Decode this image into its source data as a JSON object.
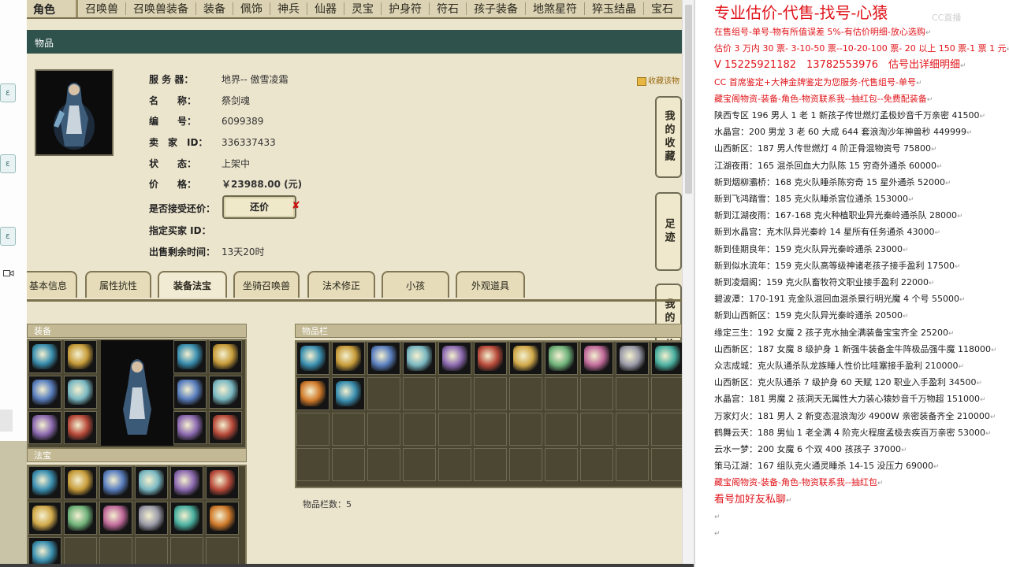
{
  "left": {
    "video_icon": "video-camera-icon"
  },
  "nav": {
    "first": "角色",
    "items": [
      "召唤兽",
      "召唤兽装备",
      "装备",
      "佩饰",
      "神兵",
      "仙器",
      "灵宝",
      "护身符",
      "符石",
      "孩子装备",
      "地煞星符",
      "猝玉结晶",
      "宝石"
    ]
  },
  "panel_title": "物品",
  "info": {
    "server_label": "服 务 器：",
    "server": "地界-- 傲雪凌霜",
    "name_label": "名　　称：",
    "name": "祭剑魂",
    "id_label": "编　　号：",
    "id": "6099389",
    "seller_label": "卖　家　ID：",
    "seller": "336337433",
    "status_label": "状　　态：",
    "status": "上架中",
    "price_label": "价　　格：",
    "price": "￥23988.00 (元)",
    "counter_label": "是否接受还价：",
    "counter_button": "还价",
    "counter_x": "✘",
    "buyer_label": "指定买家 ID：",
    "buyer": "",
    "time_label": "出售剩余时间：",
    "time": "13天20时"
  },
  "favorite": "收藏该物",
  "side_buttons": [
    "我的收藏",
    "足迹",
    "我的还价"
  ],
  "tabs": [
    "基本信息",
    "属性抗性",
    "装备法宝",
    "坐骑召唤兽",
    "法术修正",
    "小孩",
    "外观道具"
  ],
  "active_tab": "装备法宝",
  "equip_header": "装备",
  "fabao_header": "法宝",
  "inv_header": "物品栏",
  "inv_count": "物品栏数：5",
  "colors": {
    "price": "#b7110d",
    "doc_red": "#e0141a",
    "panel_green": "#2f524d"
  },
  "doc": {
    "title": "专业估价-代售-找号-心猿",
    "watermark": "CC直播",
    "lines": [
      {
        "t": "在售组号-单号-物有所值误差 5%-有估价明细-放心选购",
        "c": "red"
      },
      {
        "t": "估价 3 万内 30 票- 3-10-50 票--10-20-100 票- 20 以上 150 票-1 票 1 元",
        "c": "red"
      },
      {
        "t": "V 15225921182　13782553976　估号出详细明细",
        "c": "red",
        "big": true
      },
      {
        "t": "CC 首席鉴定+大神金牌鉴定为您服务-代售组号-单号",
        "c": "red"
      },
      {
        "t": "藏宝阁物资-装备-角色-物资联系我--抽红包--免费配装备",
        "c": "red"
      },
      {
        "t": "陕西专区 196 男人 1 老 1 新孩子传世燃灯孟极妙音千万亲密 41500",
        "c": "blk"
      },
      {
        "t": "水晶宫：200 男龙 3 老 60 大成 644 套浪淘沙年神兽秒 449999",
        "c": "blk"
      },
      {
        "t": "山西新区：187 男人传世燃灯 4 阶正骨混物资号 75800",
        "c": "blk"
      },
      {
        "t": "江湖夜雨：165 混杀回血大力队陈 15 穷奇外通杀 60000",
        "c": "blk"
      },
      {
        "t": "新到烟柳灞桥：168 克火队睡杀陈穷奇 15 星外通杀 52000",
        "c": "blk"
      },
      {
        "t": "新到飞鸿踏雪：185 克火队睡杀宫位通杀 153000",
        "c": "blk"
      },
      {
        "t": "新到江湖夜雨：167-168 克火种植职业异光秦岭通杀队 28000",
        "c": "blk"
      },
      {
        "t": "新到水晶宫：克木队异光秦岭 14 星所有任务通杀 43000",
        "c": "blk"
      },
      {
        "t": "新到佳期良年：159 克火队异光秦岭通杀 23000",
        "c": "blk"
      },
      {
        "t": "新到似水流年：159 克火队高等级神诸老孩子接手盈利 17500",
        "c": "blk"
      },
      {
        "t": "新到凌烟阁：159 克火队畜牧符文职业接手盈利 22000",
        "c": "blk"
      },
      {
        "t": "碧波潭：170-191 克金队混回血混杀景行明光魔 4 个号 55000",
        "c": "blk"
      },
      {
        "t": "新到山西新区：159 克火队异光秦岭通杀 20500",
        "c": "blk"
      },
      {
        "t": "缘定三生：192 女魔 2 孩子克水抽全满装备宝宝齐全 25200",
        "c": "blk"
      },
      {
        "t": "山西新区：187 女魔 8 级护身 1 新强牛装备金牛阵极品强牛魔 118000",
        "c": "blk"
      },
      {
        "t": "众志成城：克火队通杀队龙族睡人性价比哇塞接手盈利 210000",
        "c": "blk"
      },
      {
        "t": "山西新区：克火队通杀 7 级护身 60 天赋 120 职业入手盈利 34500",
        "c": "blk"
      },
      {
        "t": "水晶宫：181 男魔 2 孩洞天无属性大力装心猿妙音千万物超 151000",
        "c": "blk"
      },
      {
        "t": "万家灯火：181 男人 2 新变态混浪淘沙 4900W 亲密装备齐全 210000",
        "c": "blk"
      },
      {
        "t": "鹤舞云天：188 男仙 1 老全满 4 阶克火程度孟极去疾百万亲密 53000",
        "c": "blk"
      },
      {
        "t": "云水一梦：200 女魔 6 个双 400 孩孩子 37000",
        "c": "blk"
      },
      {
        "t": "策马江湖：167 组队克火通灵睡杀 14-15 没压力 69000",
        "c": "blk"
      },
      {
        "t": "藏宝阁物资-装备-角色-物资联系我--抽红包",
        "c": "red"
      },
      {
        "t": "看号加好友私聊",
        "c": "red",
        "big": true
      },
      {
        "t": "",
        "c": "blk"
      },
      {
        "t": "",
        "c": "blk"
      }
    ]
  }
}
